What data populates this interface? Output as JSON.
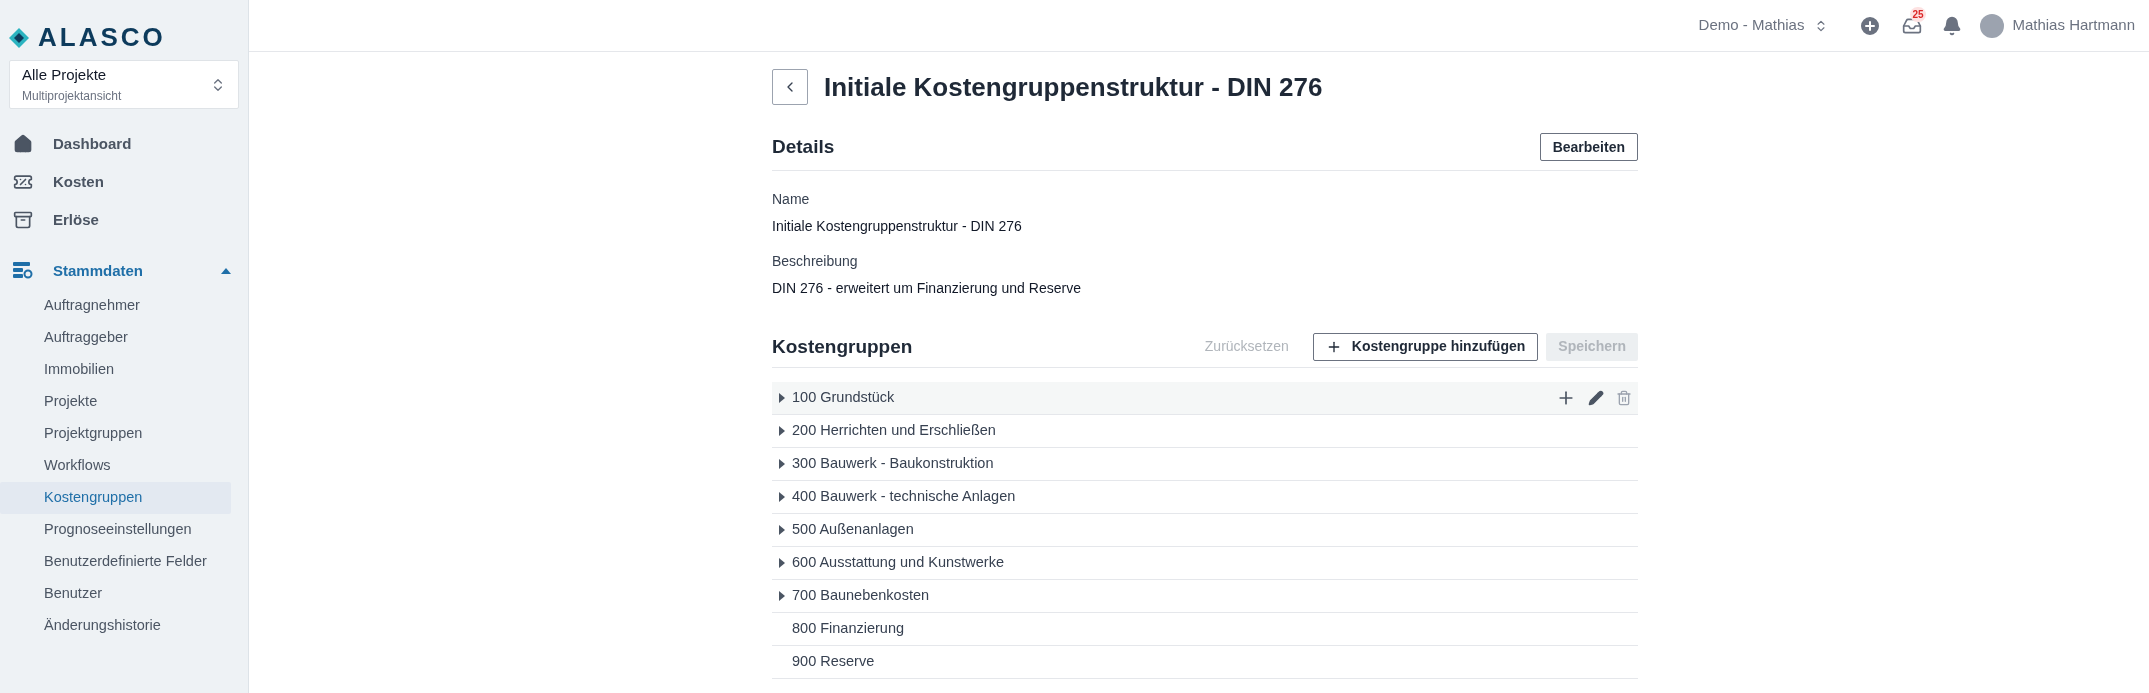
{
  "logo": {
    "text": "ALASCO"
  },
  "project_switcher": {
    "title": "Alle Projekte",
    "subtitle": "Multiprojektansicht"
  },
  "nav": [
    {
      "kind": "home",
      "label": "Dashboard",
      "selected": false
    },
    {
      "kind": "costs",
      "label": "Kosten",
      "selected": false
    },
    {
      "kind": "revenue",
      "label": "Erlöse",
      "selected": false
    }
  ],
  "section": {
    "label": "Stammdaten",
    "expanded": true,
    "items": [
      {
        "label": "Auftragnehmer",
        "selected": false
      },
      {
        "label": "Auftraggeber",
        "selected": false
      },
      {
        "label": "Immobilien",
        "selected": false
      },
      {
        "label": "Projekte",
        "selected": false
      },
      {
        "label": "Projektgruppen",
        "selected": false
      },
      {
        "label": "Workflows",
        "selected": false
      },
      {
        "label": "Kostengruppen",
        "selected": true
      },
      {
        "label": "Prognoseeinstellungen",
        "selected": false
      },
      {
        "label": "Benutzerdefinierte Felder",
        "selected": false
      },
      {
        "label": "Benutzer",
        "selected": false
      },
      {
        "label": "Änderungshistorie",
        "selected": false
      }
    ]
  },
  "topbar": {
    "workspace": "Demo - Mathias",
    "inbox_count": "25",
    "user": "Mathias Hartmann"
  },
  "page": {
    "title": "Initiale Kostengruppenstruktur - DIN 276"
  },
  "details": {
    "heading": "Details",
    "edit_button": "Bearbeiten",
    "fields": [
      {
        "label": "Name",
        "value": "Initiale Kostengruppenstruktur - DIN 276"
      },
      {
        "label": "Beschreibung",
        "value": "DIN 276 - erweitert um Finanzierung und Reserve"
      }
    ]
  },
  "cost_groups": {
    "heading": "Kostengruppen",
    "reset_button": "Zurücksetzen",
    "reset_disabled": true,
    "add_button": "Kostengruppe hinzufügen",
    "save_button": "Speichern",
    "save_disabled": true,
    "rows": [
      {
        "label": "100 Grundstück",
        "expandable": true,
        "highlighted": true
      },
      {
        "label": "200 Herrichten und Erschließen",
        "expandable": true,
        "highlighted": false
      },
      {
        "label": "300 Bauwerk - Baukonstruktion",
        "expandable": true,
        "highlighted": false
      },
      {
        "label": "400 Bauwerk - technische Anlagen",
        "expandable": true,
        "highlighted": false
      },
      {
        "label": "500 Außenanlagen",
        "expandable": true,
        "highlighted": false
      },
      {
        "label": "600 Ausstattung und Kunstwerke",
        "expandable": true,
        "highlighted": false
      },
      {
        "label": "700 Baunebenkosten",
        "expandable": true,
        "highlighted": false
      },
      {
        "label": "800 Finanzierung",
        "expandable": false,
        "highlighted": false
      },
      {
        "label": "900 Reserve",
        "expandable": false,
        "highlighted": false
      }
    ]
  }
}
